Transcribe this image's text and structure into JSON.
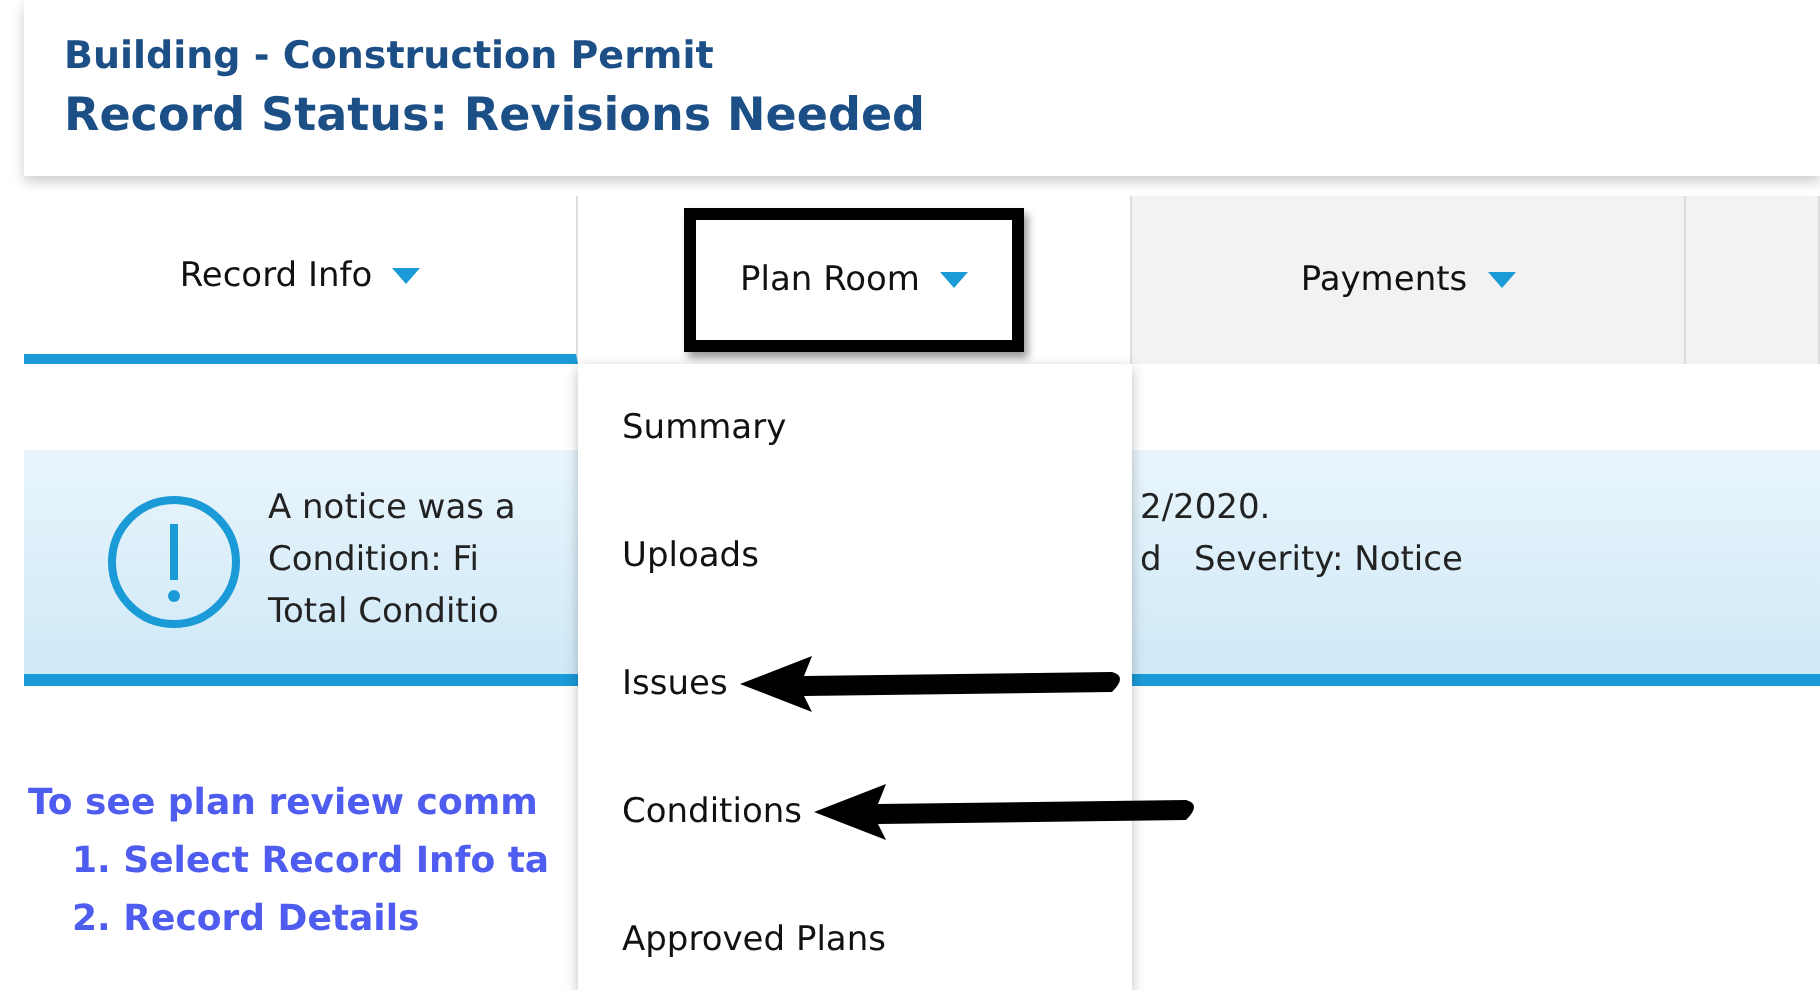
{
  "header": {
    "title": "Building - Construction Permit",
    "status": "Record Status: Revisions Needed"
  },
  "tabs": [
    {
      "label": "Record Info",
      "selected": true,
      "expanded": false,
      "highlighted": false
    },
    {
      "label": "Plan Room",
      "selected": false,
      "expanded": true,
      "highlighted": true
    },
    {
      "label": "Payments",
      "selected": false,
      "expanded": false,
      "highlighted": false
    }
  ],
  "menu": {
    "items": [
      {
        "label": "Summary",
        "pointed": false
      },
      {
        "label": "Uploads",
        "pointed": false
      },
      {
        "label": "Issues",
        "pointed": true
      },
      {
        "label": "Conditions",
        "pointed": true
      },
      {
        "label": "Approved Plans",
        "pointed": false
      }
    ]
  },
  "notice": {
    "lines": [
      {
        "left": "A notice was a",
        "right": "2/2020."
      },
      {
        "left": "Condition: Fi",
        "right": "d   Severity: Notice"
      },
      {
        "left": "Total Conditio"
      }
    ]
  },
  "instructions": {
    "heading": "To see plan review comm",
    "steps": [
      "1. Select Record Info ta",
      "2. Record Details"
    ]
  }
}
